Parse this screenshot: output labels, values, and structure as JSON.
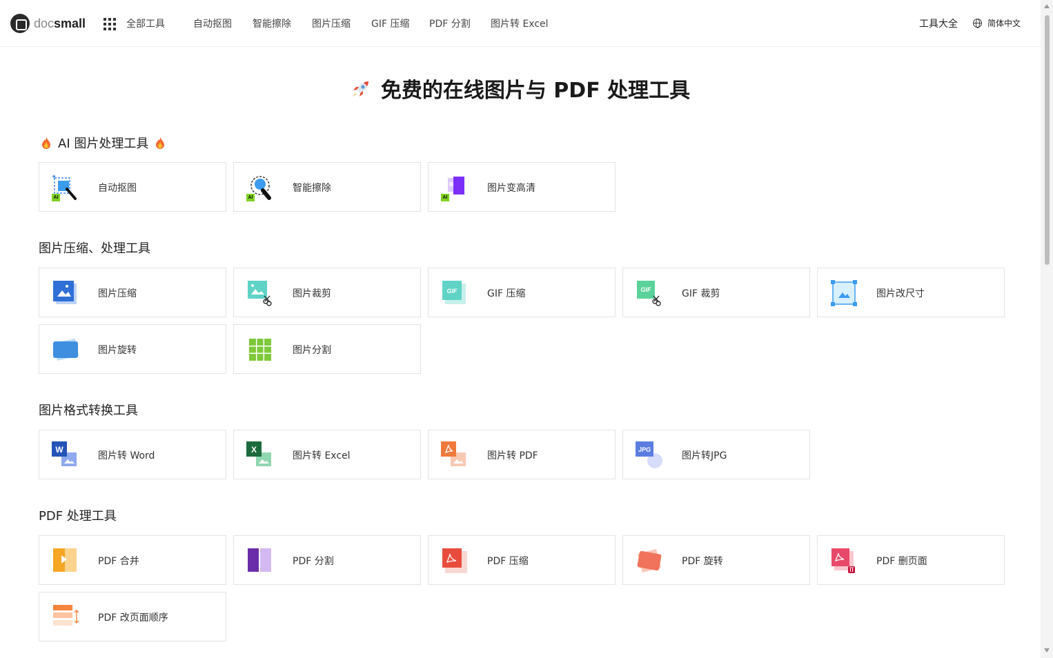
{
  "header": {
    "logo": {
      "doc": "doc",
      "small": "small"
    },
    "all_tools": "全部工具",
    "nav": [
      "自动抠图",
      "智能擦除",
      "图片压缩",
      "GIF 压缩",
      "PDF 分割",
      "图片转 Excel"
    ],
    "tools_all": "工具大全",
    "language": "简体中文"
  },
  "hero": {
    "title": "免费的在线图片与 PDF 处理工具"
  },
  "sections": [
    {
      "title": "AI 图片处理工具",
      "items": [
        "自动抠图",
        "智能擦除",
        "图片变高清"
      ]
    },
    {
      "title": "图片压缩、处理工具",
      "items": [
        "图片压缩",
        "图片裁剪",
        "GIF 压缩",
        "GIF 裁剪",
        "图片改尺寸",
        "图片旋转",
        "图片分割"
      ]
    },
    {
      "title": "图片格式转换工具",
      "items": [
        "图片转 Word",
        "图片转 Excel",
        "图片转 PDF",
        "图片转JPG"
      ]
    },
    {
      "title": "PDF 处理工具",
      "items": [
        "PDF 合并",
        "PDF 分割",
        "PDF 压缩",
        "PDF 旋转",
        "PDF 删页面",
        "PDF 改页面顺序"
      ]
    }
  ],
  "badges": {
    "ai": "AI",
    "gif": "GIF",
    "word": "W",
    "excel": "X",
    "jpg": "JPG"
  },
  "colors": {
    "accent_blue": "#3b82f6",
    "ai_green": "#7ed321",
    "pdf_red": "#e84c3d",
    "purple": "#7b2ff7"
  }
}
